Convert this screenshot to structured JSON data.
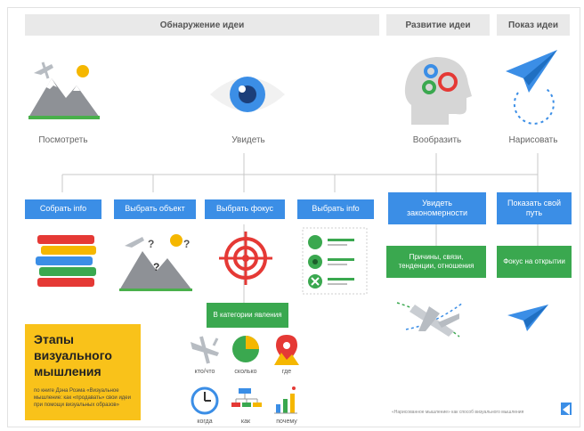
{
  "headers": {
    "discovery": "Обнаружение идеи",
    "development": "Развитие идеи",
    "show": "Показ идеи"
  },
  "stages": {
    "look": "Посмотреть",
    "see": "Увидеть",
    "imagine": "Вообразить",
    "draw": "Нарисовать"
  },
  "steps": {
    "collect": "Собрать info",
    "choose_object": "Выбрать объект",
    "choose_focus": "Выбрать фокус",
    "choose_info": "Выбрать info",
    "see_patterns": "Увидеть закономерности",
    "show_path": "Показать свой путь"
  },
  "green": {
    "categories": "В категории явления",
    "causes": "Причины, связи, тенденции, отношения",
    "focus_on_insight": "Фокус на открытии"
  },
  "categories": {
    "who": "кто/что",
    "how_much": "сколько",
    "where": "где",
    "when": "когда",
    "how": "как",
    "why": "почему"
  },
  "yellow_box": {
    "title": "Этапы\nвизуального\nмышления",
    "text": "по книге Дэна Роэма «Визуальное мышление: как «продавать» свои идеи при помощи визуальных образов»"
  },
  "footer": "«Нарисованное мышление» как способ визуального мышления",
  "colors": {
    "blue": "#3b8ee6",
    "green": "#3aa84f",
    "yellow": "#f9c21a",
    "red": "#e53935",
    "gray": "#e9e9e9"
  }
}
